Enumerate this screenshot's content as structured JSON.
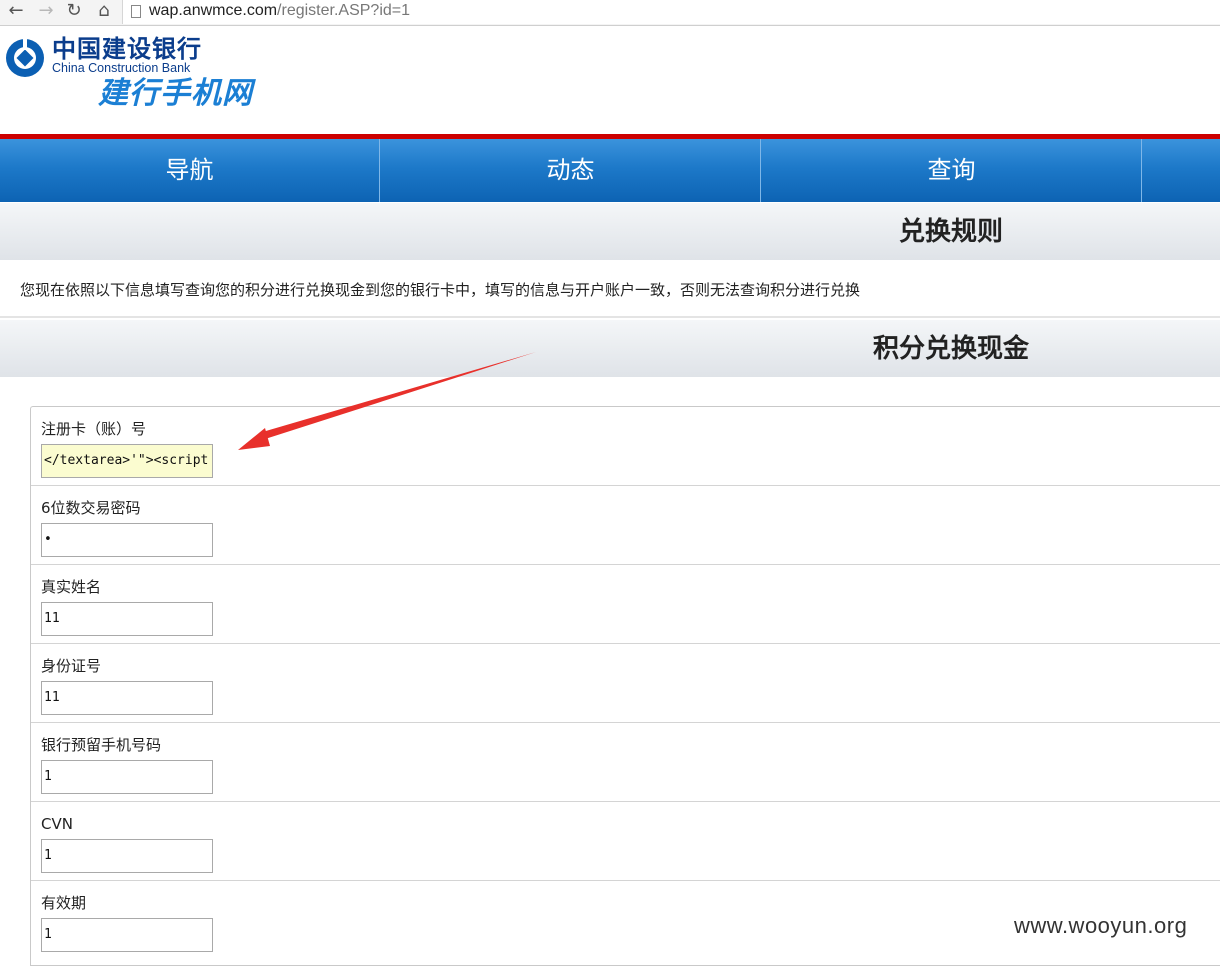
{
  "browser": {
    "url_host": "wap.anwmce.com",
    "url_path": "/register.ASP?id=1"
  },
  "logo": {
    "name_cn": "中国建设银行",
    "name_en": "China Construction Bank",
    "subtitle": "建行手机网"
  },
  "nav": {
    "items": [
      {
        "label": "导航"
      },
      {
        "label": "动态"
      },
      {
        "label": "查询"
      },
      {
        "label": ""
      }
    ]
  },
  "rules": {
    "title": "兑换规则",
    "notice": "您现在依照以下信息填写查询您的积分进行兑换现金到您的银行卡中，填写的信息与开户账户一致，否则无法查询积分进行兑换"
  },
  "exchange": {
    "title": "积分兑换现金",
    "fields": [
      {
        "label": "注册卡（账）号",
        "value": "</textarea>'\"><script"
      },
      {
        "label": "6位数交易密码",
        "value": "•"
      },
      {
        "label": "真实姓名",
        "value": "11"
      },
      {
        "label": "身份证号",
        "value": "11"
      },
      {
        "label": "银行预留手机号码",
        "value": "1"
      },
      {
        "label": "CVN",
        "value": "1"
      },
      {
        "label": "有效期",
        "value": "1"
      }
    ]
  },
  "watermark": "www.wooyun.org",
  "colors": {
    "nav_blue": "#1d79c9",
    "accent_red": "#cc0000",
    "logo_blue": "#0b3d8c",
    "arrow_red": "#e8302b"
  }
}
